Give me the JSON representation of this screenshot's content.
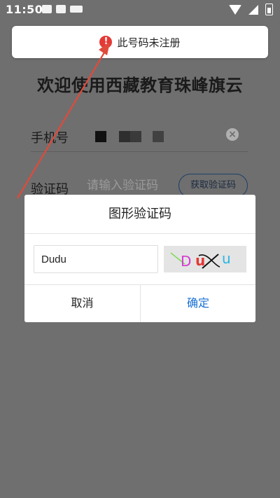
{
  "status_bar": {
    "time": "11:50",
    "left_icons": [
      "image-icon",
      "font-icon",
      "keyboard-icon"
    ],
    "right_icons": [
      "wifi-icon",
      "signal-icon",
      "battery-icon"
    ]
  },
  "toast": {
    "icon": "alert-icon",
    "icon_glyph": "!",
    "text": "此号码未注册"
  },
  "page": {
    "title": "欢迎使用西藏教育珠峰旗云",
    "phone_label": "手机号",
    "clear_glyph": "×",
    "code_label": "验证码",
    "code_placeholder": "请输入验证码",
    "get_code_button": "获取验证码"
  },
  "dialog": {
    "title": "图形验证码",
    "input_value": "Dudu",
    "captcha_chars": [
      "D",
      "u",
      "u"
    ],
    "cancel": "取消",
    "confirm": "确定"
  },
  "colors": {
    "overlay": "#6f6f6f",
    "accent": "#1a6fd4",
    "alert": "#e53935",
    "arrow": "#e04a3a"
  }
}
